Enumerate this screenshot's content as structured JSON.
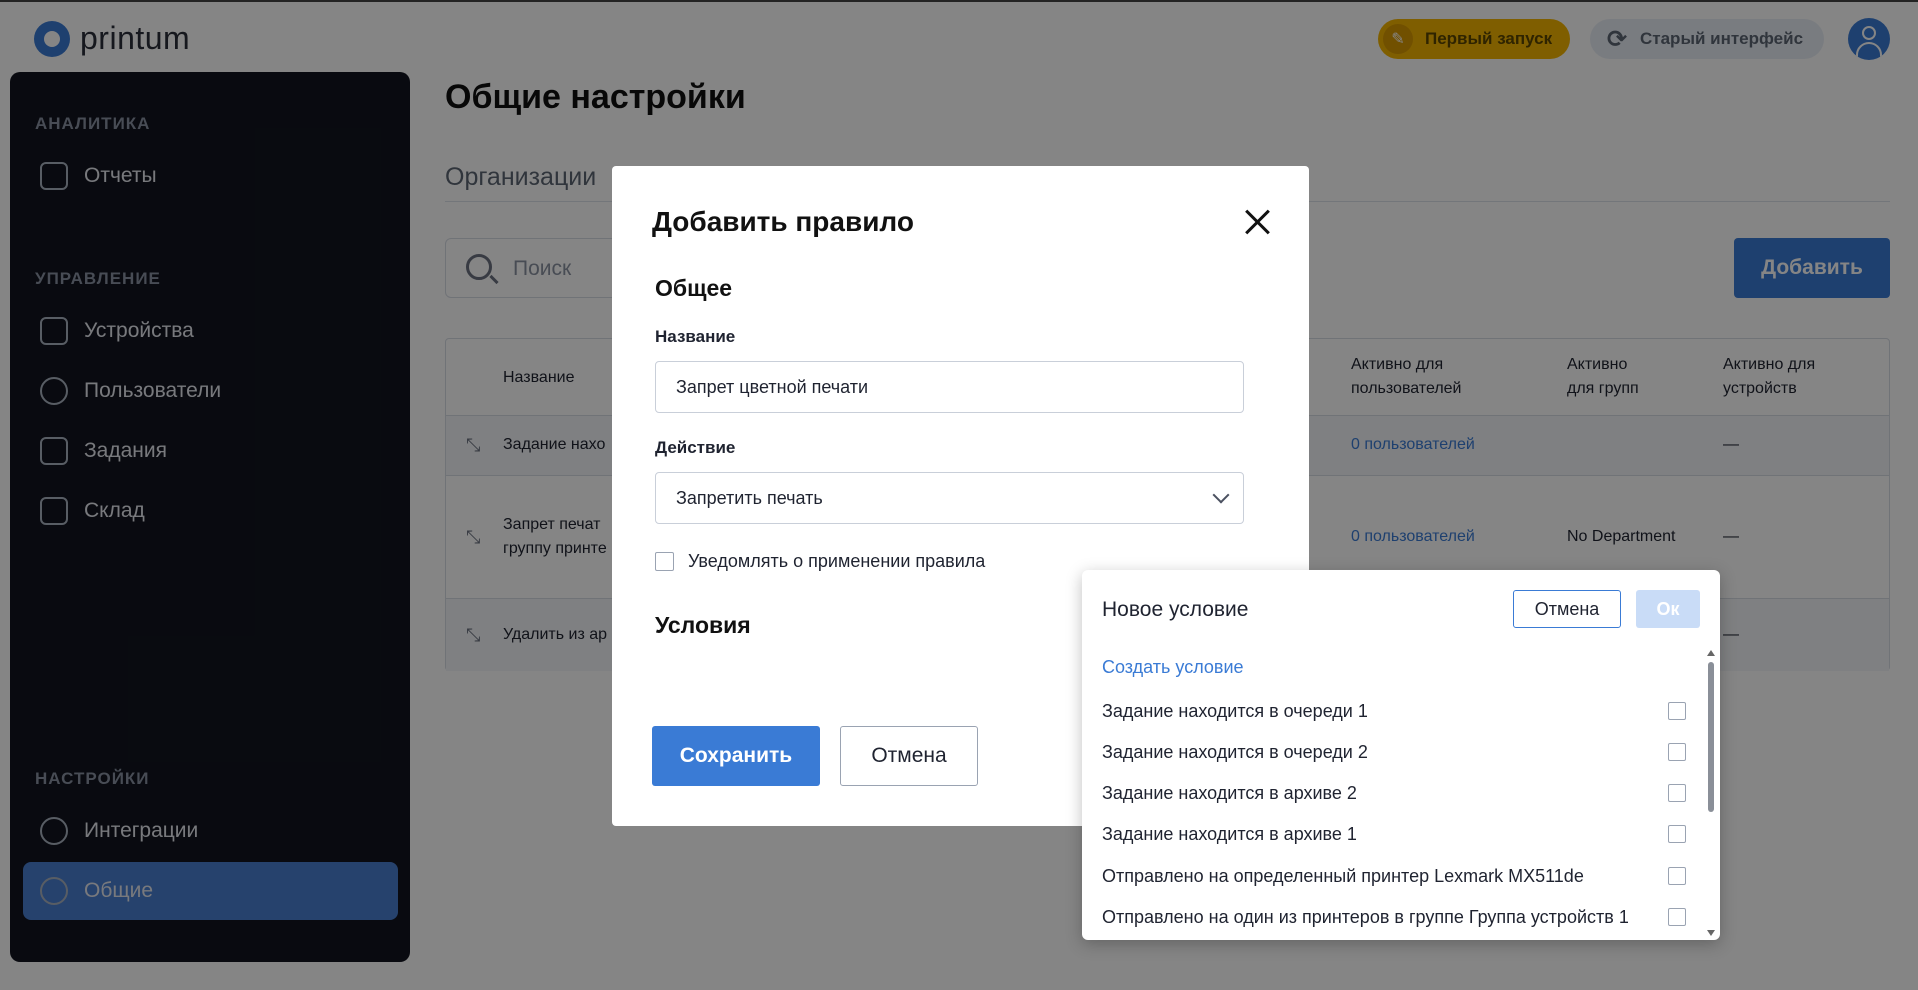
{
  "header": {
    "logo_text": "printum",
    "first_launch_label": "Первый запуск",
    "old_interface_label": "Старый интерфейс"
  },
  "sidebar": {
    "sections": [
      {
        "title": "АНАЛИТИКА",
        "items": [
          {
            "label": "Отчеты",
            "icon": "file-icon"
          }
        ]
      },
      {
        "title": "УПРАВЛЕНИЕ",
        "items": [
          {
            "label": "Устройства",
            "icon": "printer-icon"
          },
          {
            "label": "Пользователи",
            "icon": "user-icon"
          },
          {
            "label": "Задания",
            "icon": "clipboard-icon"
          },
          {
            "label": "Склад",
            "icon": "store-icon"
          }
        ]
      },
      {
        "title": "НАСТРОЙКИ",
        "items": [
          {
            "label": "Интеграции",
            "icon": "sync-icon"
          },
          {
            "label": "Общие",
            "icon": "gear-icon",
            "active": true
          }
        ]
      }
    ]
  },
  "main": {
    "page_title": "Общие настройки",
    "tab_label": "Организации",
    "search_placeholder": "Поиск",
    "add_label": "Добавить",
    "table": {
      "headers": {
        "name": "Название",
        "users_line1": "Активно для",
        "users_line2": "пользователей",
        "groups_line1": "Активно",
        "groups_line2": "для групп",
        "devices_line1": "Активно для",
        "devices_line2": "устройств"
      },
      "rows": [
        {
          "name_line1": "Задание нахо",
          "name_line2": "",
          "users": "0 пользователей",
          "groups": "",
          "devices": "—"
        },
        {
          "name_line1": "Запрет печат",
          "name_line2": "группу принте",
          "users": "0 пользователей",
          "groups": "No Department",
          "devices": "—"
        },
        {
          "name_line1": "Удалить из ар",
          "name_line2": "",
          "users": "",
          "groups": "",
          "devices": "—"
        }
      ]
    }
  },
  "dialog": {
    "title": "Добавить правило",
    "general_heading": "Общее",
    "name_label": "Название",
    "name_value": "Запрет цветной печати",
    "action_label": "Действие",
    "action_value": "Запретить печать",
    "notify_label": "Уведомлять о применении правила",
    "notify_checked": false,
    "conditions_heading": "Условия",
    "save_label": "Сохранить",
    "cancel_label": "Отмена"
  },
  "condition_popup": {
    "title": "Новое условие",
    "cancel_label": "Отмена",
    "ok_label": "Ок",
    "create_label": "Создать условие",
    "items": [
      {
        "label": "Задание находится в очереди 1",
        "checked": false
      },
      {
        "label": "Задание находится в очереди 2",
        "checked": false
      },
      {
        "label": "Задание находится в архиве 2",
        "checked": false
      },
      {
        "label": "Задание находится в архиве 1",
        "checked": false
      },
      {
        "label": "Отправлено на определенный принтер Lexmark MX511de",
        "checked": false
      },
      {
        "label": "Отправлено на один из принтеров в группе Группа устройств 1",
        "checked": false
      }
    ]
  },
  "colors": {
    "accent": "#3a7bd5",
    "sidebar_bg": "#12151f",
    "first_launch": "#f4b400",
    "ok_disabled": "#c9dcf7"
  }
}
